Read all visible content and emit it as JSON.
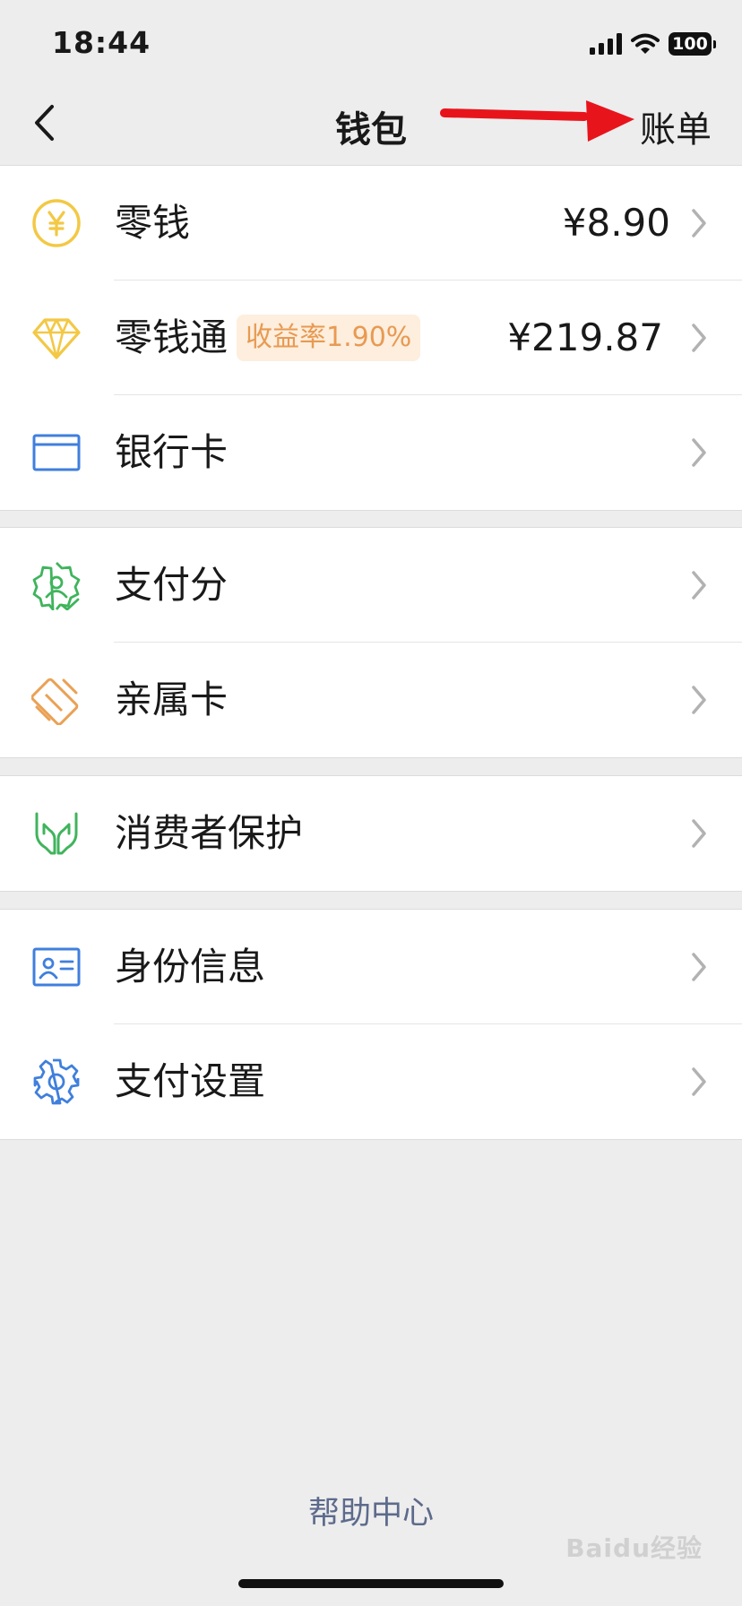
{
  "status_bar": {
    "time": "18:44",
    "battery": "100"
  },
  "nav": {
    "title": "钱包",
    "right_label": "账单"
  },
  "groups": [
    {
      "rows": [
        {
          "label": "零钱",
          "value": "¥8.90",
          "icon": "yuan-coin-icon"
        },
        {
          "label": "零钱通",
          "badge": "收益率1.90%",
          "value": "¥219.87",
          "icon": "diamond-icon"
        },
        {
          "label": "银行卡",
          "icon": "bank-card-icon"
        }
      ]
    },
    {
      "rows": [
        {
          "label": "支付分",
          "icon": "pay-score-badge-icon"
        },
        {
          "label": "亲属卡",
          "icon": "family-card-icon"
        }
      ]
    },
    {
      "rows": [
        {
          "label": "消费者保护",
          "icon": "protection-hands-icon"
        }
      ]
    },
    {
      "rows": [
        {
          "label": "身份信息",
          "icon": "id-card-icon"
        },
        {
          "label": "支付设置",
          "icon": "gear-icon"
        }
      ]
    }
  ],
  "footer": {
    "help_label": "帮助中心",
    "watermark": "Baidu经验"
  },
  "colors": {
    "background": "#ededed",
    "annotation_arrow": "#e8141c",
    "help_link": "#5d6a8c",
    "badge_text": "#e89a52",
    "badge_bg": "#fdeedd"
  }
}
